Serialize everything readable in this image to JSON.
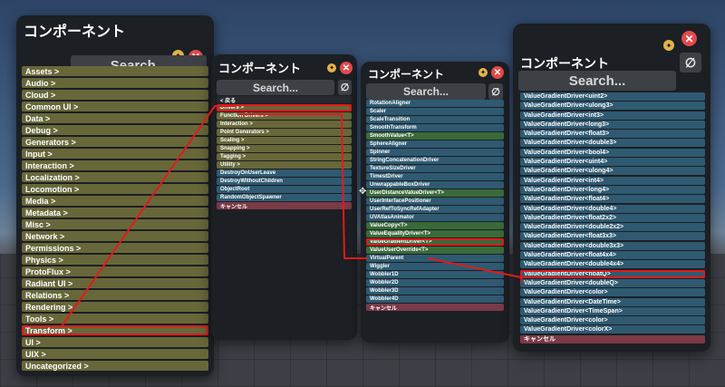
{
  "panel_title": "コンポーネント",
  "search_placeholder": "Search...",
  "clear_glyph": "∅",
  "center_glyph": "✥",
  "panel1": {
    "items": [
      "Assets >",
      "Audio >",
      "Cloud >",
      "Common UI >",
      "Data >",
      "Debug >",
      "Generators >",
      "Input >",
      "Interaction >",
      "Localization >",
      "Locomotion >",
      "Media >",
      "Metadata >",
      "Misc >",
      "Network >",
      "Permissions >",
      "Physics >",
      "ProtoFlux >",
      "Radiant UI >",
      "Relations >",
      "Rendering >",
      "Tools >",
      "Transform >",
      "UI >",
      "UIX >",
      "Uncategorized >"
    ],
    "highlighted": "Transform >"
  },
  "panel2": {
    "items": [
      {
        "label": "< 戻る",
        "style": "dark"
      },
      {
        "label": "Drivers >",
        "style": "olive"
      },
      {
        "label": "Function Drivers >",
        "style": "olive"
      },
      {
        "label": "Interaction >",
        "style": "olive"
      },
      {
        "label": "Point Generators >",
        "style": "olive"
      },
      {
        "label": "Scaling >",
        "style": "olive"
      },
      {
        "label": "Snapping >",
        "style": "olive"
      },
      {
        "label": "Tagging >",
        "style": "olive"
      },
      {
        "label": "Utility >",
        "style": "olive"
      },
      {
        "label": "DestroyOnUserLeave",
        "style": "teal"
      },
      {
        "label": "DestroyWithoutChildren",
        "style": "teal"
      },
      {
        "label": "ObjectRoot",
        "style": "teal"
      },
      {
        "label": "RandomObjectSpawner",
        "style": "teal"
      },
      {
        "label": "キャンセル",
        "style": "red"
      }
    ],
    "highlighted": "Drivers >"
  },
  "panel3": {
    "items": [
      {
        "label": "RotationAligner",
        "style": "teal"
      },
      {
        "label": "Scaler",
        "style": "teal"
      },
      {
        "label": "ScaleTransition",
        "style": "teal"
      },
      {
        "label": "SmoothTransform",
        "style": "teal"
      },
      {
        "label": "SmoothValue<T>",
        "style": "green"
      },
      {
        "label": "SphereAligner",
        "style": "teal"
      },
      {
        "label": "Spinner",
        "style": "teal"
      },
      {
        "label": "StringConcatenationDriver",
        "style": "teal"
      },
      {
        "label": "TextureSizeDriver",
        "style": "teal"
      },
      {
        "label": "TimestDriver",
        "style": "teal"
      },
      {
        "label": "UnwrappableBoxDriver",
        "style": "teal"
      },
      {
        "label": "UserDistanceValueDriver<T>",
        "style": "green"
      },
      {
        "label": "UserInterfacePositioner",
        "style": "teal"
      },
      {
        "label": "UserRefToSyncRefAdapter",
        "style": "teal"
      },
      {
        "label": "UVAtlasAnimator",
        "style": "teal"
      },
      {
        "label": "ValueCopy<T>",
        "style": "green"
      },
      {
        "label": "ValueEqualityDriver<T>",
        "style": "green"
      },
      {
        "label": "ValueGradientDriver<T>",
        "style": "green"
      },
      {
        "label": "ValueUserOverride<T>",
        "style": "green"
      },
      {
        "label": "VirtualParent",
        "style": "teal"
      },
      {
        "label": "Wiggler",
        "style": "teal"
      },
      {
        "label": "Wobbler1D",
        "style": "teal"
      },
      {
        "label": "Wobbler2D",
        "style": "teal"
      },
      {
        "label": "Wobbler3D",
        "style": "teal"
      },
      {
        "label": "Wobbler4D",
        "style": "teal"
      },
      {
        "label": "キャンセル",
        "style": "red"
      }
    ],
    "highlighted": "ValueGradientDriver<T>"
  },
  "panel4": {
    "items": [
      {
        "label": "ValueGradientDriver<uint2>",
        "style": "teal"
      },
      {
        "label": "ValueGradientDriver<ulong3>",
        "style": "teal"
      },
      {
        "label": "ValueGradientDriver<int3>",
        "style": "teal"
      },
      {
        "label": "ValueGradientDriver<long3>",
        "style": "teal"
      },
      {
        "label": "ValueGradientDriver<float3>",
        "style": "teal"
      },
      {
        "label": "ValueGradientDriver<double3>",
        "style": "teal"
      },
      {
        "label": "ValueGradientDriver<bool4>",
        "style": "teal"
      },
      {
        "label": "ValueGradientDriver<uint4>",
        "style": "teal"
      },
      {
        "label": "ValueGradientDriver<ulong4>",
        "style": "teal"
      },
      {
        "label": "ValueGradientDriver<int4>",
        "style": "teal"
      },
      {
        "label": "ValueGradientDriver<long4>",
        "style": "teal"
      },
      {
        "label": "ValueGradientDriver<float4>",
        "style": "teal"
      },
      {
        "label": "ValueGradientDriver<double4>",
        "style": "teal"
      },
      {
        "label": "ValueGradientDriver<float2x2>",
        "style": "teal"
      },
      {
        "label": "ValueGradientDriver<double2x2>",
        "style": "teal"
      },
      {
        "label": "ValueGradientDriver<float3x3>",
        "style": "teal"
      },
      {
        "label": "ValueGradientDriver<double3x3>",
        "style": "teal"
      },
      {
        "label": "ValueGradientDriver<float4x4>",
        "style": "teal"
      },
      {
        "label": "ValueGradientDriver<double4x4>",
        "style": "teal"
      },
      {
        "label": "ValueGradientDriver<floatQ>",
        "style": "teal"
      },
      {
        "label": "ValueGradientDriver<doubleQ>",
        "style": "teal"
      },
      {
        "label": "ValueGradientDriver<color>",
        "style": "teal"
      },
      {
        "label": "ValueGradientDriver<DateTime>",
        "style": "teal"
      },
      {
        "label": "ValueGradientDriver<TimeSpan>",
        "style": "teal"
      },
      {
        "label": "ValueGradientDriver<color>",
        "style": "teal"
      },
      {
        "label": "ValueGradientDriver<colorX>",
        "style": "teal"
      },
      {
        "label": "キャンセル",
        "style": "red"
      }
    ],
    "highlighted": "ValueGradientDriver<floatQ>"
  },
  "colors": {
    "olive": "#68673a",
    "teal": "#2f5a72",
    "green": "#3a6a3a",
    "cancel": "#7a3a46",
    "highlight": "#e21a1a"
  }
}
